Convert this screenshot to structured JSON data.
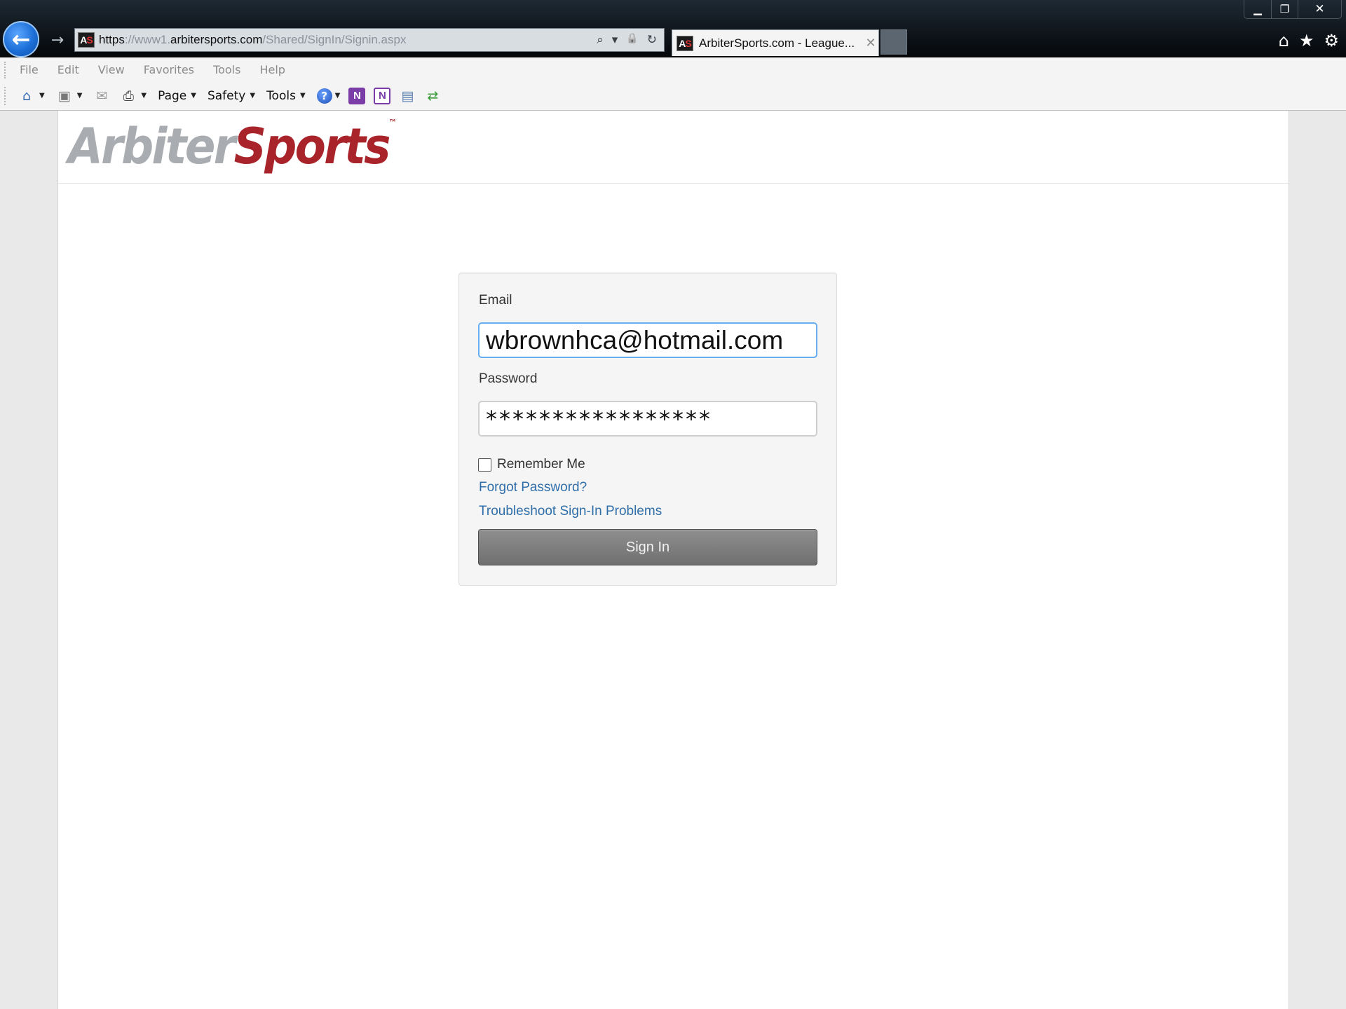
{
  "browser": {
    "url_scheme": "https",
    "url_prefix": "://www1.",
    "url_domain": "arbitersports.com",
    "url_path": "/Shared/SignIn/Signin.aspx",
    "favicon_text_a": "A",
    "favicon_text_s": "S",
    "tab_title": "ArbiterSports.com - League...",
    "tab_close": "✕",
    "window_controls": {
      "minimize": "▁",
      "restore": "❐",
      "close": "✕"
    },
    "right_icons": {
      "home": "⌂",
      "favorites": "★",
      "settings": "⚙"
    },
    "back_glyph": "←",
    "forward_glyph": "→",
    "address_icons": {
      "search": "⌕",
      "dropdown": "▾",
      "lock": "🔒",
      "refresh": "↻"
    }
  },
  "menu": {
    "items": [
      "File",
      "Edit",
      "View",
      "Favorites",
      "Tools",
      "Help"
    ]
  },
  "commandbar": {
    "page_label": "Page",
    "safety_label": "Safety",
    "tools_label": "Tools",
    "help_glyph": "?",
    "onenote_glyph": "N",
    "caret": "▼",
    "icons": {
      "home": "⌂",
      "feeds": "▣",
      "mail": "✉",
      "print": "⎙",
      "research": "▤",
      "translate": "⇄"
    }
  },
  "site": {
    "logo_part1": "Arbiter",
    "logo_part2": "Sports",
    "logo_tm": "™"
  },
  "signin": {
    "email_label": "Email",
    "email_value": "wbrownhca@hotmail.com",
    "password_label": "Password",
    "password_value": "*****************",
    "remember_label": "Remember Me",
    "remember_checked": false,
    "forgot_link": "Forgot Password?",
    "troubleshoot_link": "Troubleshoot Sign-In Problems",
    "signin_button": "Sign In"
  },
  "colors": {
    "brand_red": "#a8232a",
    "brand_gray": "#a9acb0",
    "link_blue": "#2f6ea9",
    "focus_blue": "#66aef0",
    "button_gray": "#7f7f7f"
  }
}
